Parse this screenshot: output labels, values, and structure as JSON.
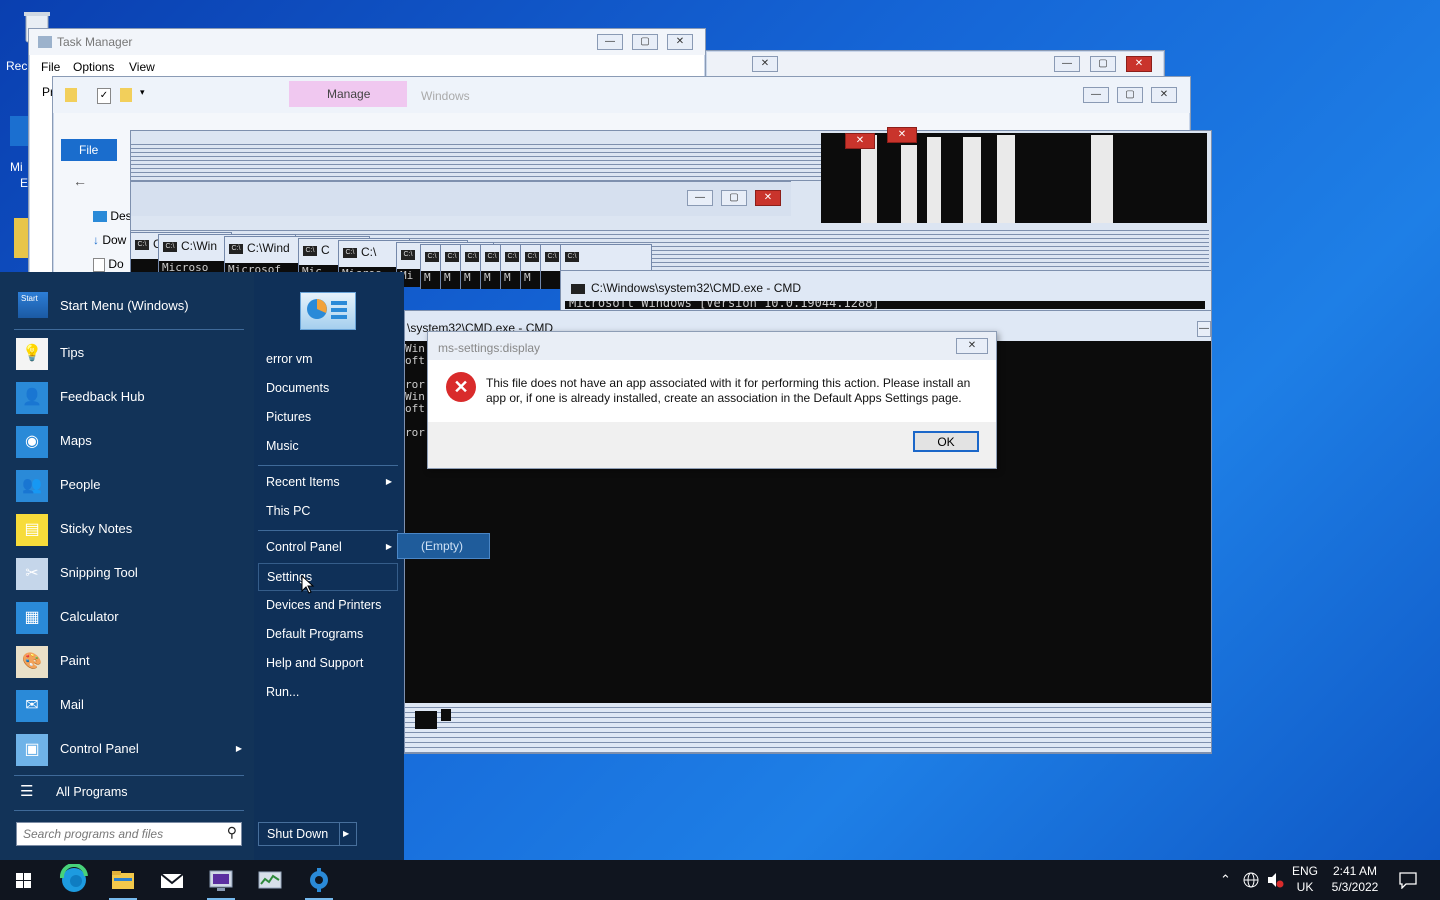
{
  "desktop": {
    "recycle_label": "Rec",
    "ms_label_1": "Mi",
    "ms_label_2": "E"
  },
  "task_manager": {
    "title": "Task Manager",
    "menu": [
      "File",
      "Options",
      "View"
    ],
    "tab_fragment": "Pr"
  },
  "explorer": {
    "tab_manage": "Manage",
    "tab_windows": "Windows",
    "file_tab": "File",
    "nav_items": [
      "Des",
      "Dow",
      "Do"
    ]
  },
  "cmd_windows": {
    "main_title": "C:\\Windows\\system32\\CMD.exe - CMD",
    "main_line": "Microsoft Windows [Version 10.0.19044.1288]",
    "second_title": "\\system32\\CMD.exe - CMD",
    "mini_titles": [
      "C:\\V",
      "C:\\Win",
      "C:\\Wind",
      "C",
      "C:\\",
      "",
      "",
      "",
      "",
      "",
      "",
      "",
      "",
      ""
    ],
    "mini_lines": [
      "",
      "Microso",
      "Microsof",
      "Mic",
      "Micros",
      "Mi",
      "M",
      "M",
      "M",
      "M",
      "M",
      "M",
      "",
      ""
    ],
    "side_text": [
      "Win",
      "oft",
      "",
      "ror",
      "Win",
      "oft",
      "",
      "ror"
    ]
  },
  "dialog": {
    "title": "ms-settings:display",
    "message_1": "This file does not have an app associated with it for performing this action. Please install an",
    "message_2": "app or, if one is already installed, create an association in the Default Apps Settings page.",
    "ok": "OK"
  },
  "start_menu": {
    "header": "Start Menu (Windows)",
    "header_icon_text": "Start",
    "pinned": [
      "Tips",
      "Feedback Hub",
      "Maps",
      "People",
      "Sticky Notes",
      "Snipping Tool",
      "Calculator",
      "Paint",
      "Mail",
      "Control Panel"
    ],
    "all_programs": "All Programs",
    "search_placeholder": "Search programs and files",
    "right": {
      "user": "error vm",
      "documents": "Documents",
      "pictures": "Pictures",
      "music": "Music",
      "recent_items": "Recent Items",
      "this_pc": "This PC",
      "control_panel": "Control Panel",
      "settings": "Settings",
      "devices_printers": "Devices and Printers",
      "default_programs": "Default Programs",
      "help_support": "Help and Support",
      "run": "Run..."
    },
    "shutdown": "Shut Down",
    "submenu_empty": "(Empty)"
  },
  "taskbar": {
    "lang_1": "ENG",
    "lang_2": "UK",
    "time": "2:41 AM",
    "date": "5/3/2022"
  },
  "colors": {
    "accent": "#1e7fe6",
    "start_menu_bg": "#123358",
    "dialog_error": "#d92b2b"
  }
}
